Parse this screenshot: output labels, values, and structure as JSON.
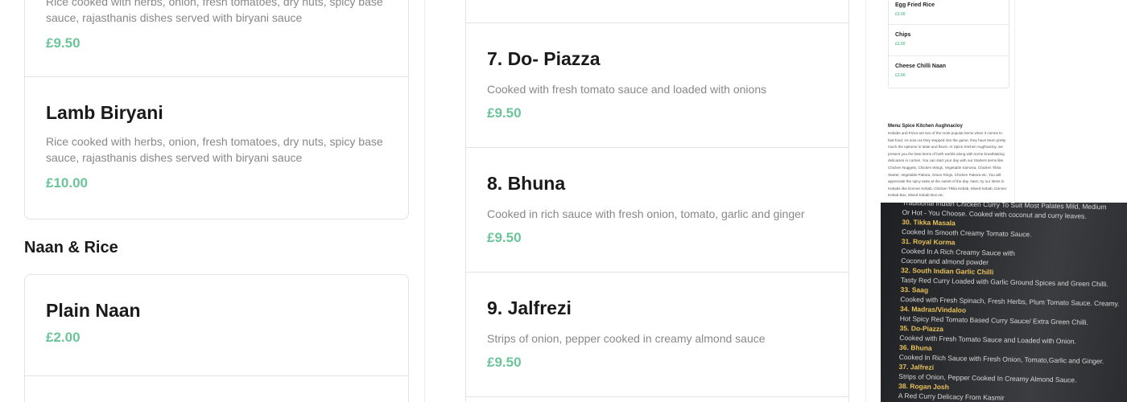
{
  "left_column": {
    "partial_item": {
      "desc": "Rice cooked with herbs, onion, fresh tomatoes, dry nuts, spicy base sauce, rajasthanis dishes served with biryani sauce",
      "price": "£9.50"
    },
    "lamb_biryani": {
      "title": "Lamb Biryani",
      "desc": "Rice cooked with herbs, onion, fresh tomatoes, dry nuts, spicy base sauce, rajasthanis dishes served with biryani sauce",
      "price": "£10.00"
    },
    "section_heading": "Naan & Rice",
    "plain_naan": {
      "title": "Plain Naan",
      "price": "£2.00"
    }
  },
  "middle_column": {
    "items": [
      {
        "title": "7. Do- Piazza",
        "desc": "Cooked with fresh tomato sauce and loaded with onions",
        "price": "£9.50"
      },
      {
        "title": "8. Bhuna",
        "desc": "Cooked in rich sauce with fresh onion, tomato, garlic and ginger",
        "price": "£9.50"
      },
      {
        "title": "9. Jalfrezi",
        "desc": "Strips of onion, pepper cooked in creamy almond sauce",
        "price": "£9.50"
      }
    ]
  },
  "mini_menu": {
    "items": [
      {
        "title": "Egg Fried Rice",
        "price": "£3.00"
      },
      {
        "title": "Chips",
        "price": "£2.50"
      },
      {
        "title": "Cheese Chilli Naan",
        "price": "£3.00"
      }
    ],
    "about_title": "Menu Spice Kitchen Aughnacloy",
    "about_body": "Kebabs and Pizza are two of the most popular items when it comes to fast-food. As soon as they stepped into the game, they have been pretty much the epitome in taste and flavor. At Spice Kitchen Aughnacloy, we present you the best items of both worlds along with some breathtaking delicacies in curries. You can start your day with our Starters items like Chicken Nuggets, Chicken Wings, Vegetable Samosa, Chicken Tikka Starter, Vegetable Pakora, Onion Rings, Chicken Pakora etc. You will appreciate the spicy taste at the outset of the day. Next, try our items in Kebabs like Donner Kebab, Chicken Tikka Kebab, Mixed Kebab, Donner Kebab Box, Mixed Kebab Box etc."
  },
  "photo_menu": {
    "lines": [
      {
        "kind": "desc",
        "text": "Traditional Indian Chicken Curry To Suit Most Palates Mild, Medium"
      },
      {
        "kind": "desc",
        "text": "Or Hot - You Choose. Cooked with coconut and curry leaves."
      },
      {
        "kind": "name",
        "text": "30. Tikka Masala"
      },
      {
        "kind": "desc",
        "text": "Cooked In Smooth Creamy Tomato Sauce."
      },
      {
        "kind": "name",
        "text": "31. Royal Korma"
      },
      {
        "kind": "desc",
        "text": "Cooked In A Rich Creamy Sauce with"
      },
      {
        "kind": "desc",
        "text": "Coconut and almond powder"
      },
      {
        "kind": "name",
        "text": "32. South Indian Garlic Chilli"
      },
      {
        "kind": "desc",
        "text": "Tasty Red Curry Loaded with Garlic Ground Spices and Green Chilli."
      },
      {
        "kind": "name",
        "text": "33. Saag"
      },
      {
        "kind": "desc",
        "text": "Cooked with Fresh Spinach, Fresh Herbs, Plum Tomato Sauce. Creamy."
      },
      {
        "kind": "name",
        "text": "34. Madras/Vindaloo"
      },
      {
        "kind": "desc",
        "text": "Hot Spicy Red Tomato Based Curry Sauce/ Extra Green Chilli."
      },
      {
        "kind": "name",
        "text": "35. Do-Piazza"
      },
      {
        "kind": "desc",
        "text": "Cooked with Fresh Tomato Sauce and Loaded with Onion."
      },
      {
        "kind": "name",
        "text": "36. Bhuna"
      },
      {
        "kind": "desc",
        "text": "Cooked In Rich Sauce with Fresh Onion, Tomato,Garlic and Ginger."
      },
      {
        "kind": "name",
        "text": "37. Jalfrezi"
      },
      {
        "kind": "desc",
        "text": "Strips of Onion, Pepper Cooked In Creamy Almond Sauce."
      },
      {
        "kind": "name",
        "text": "38. Rogan Josh"
      },
      {
        "kind": "desc",
        "text": "A Red Curry Delicacy From Kasmir"
      }
    ]
  },
  "colors": {
    "price": "#6cc59a",
    "photo_item_name": "#e7c15a"
  }
}
